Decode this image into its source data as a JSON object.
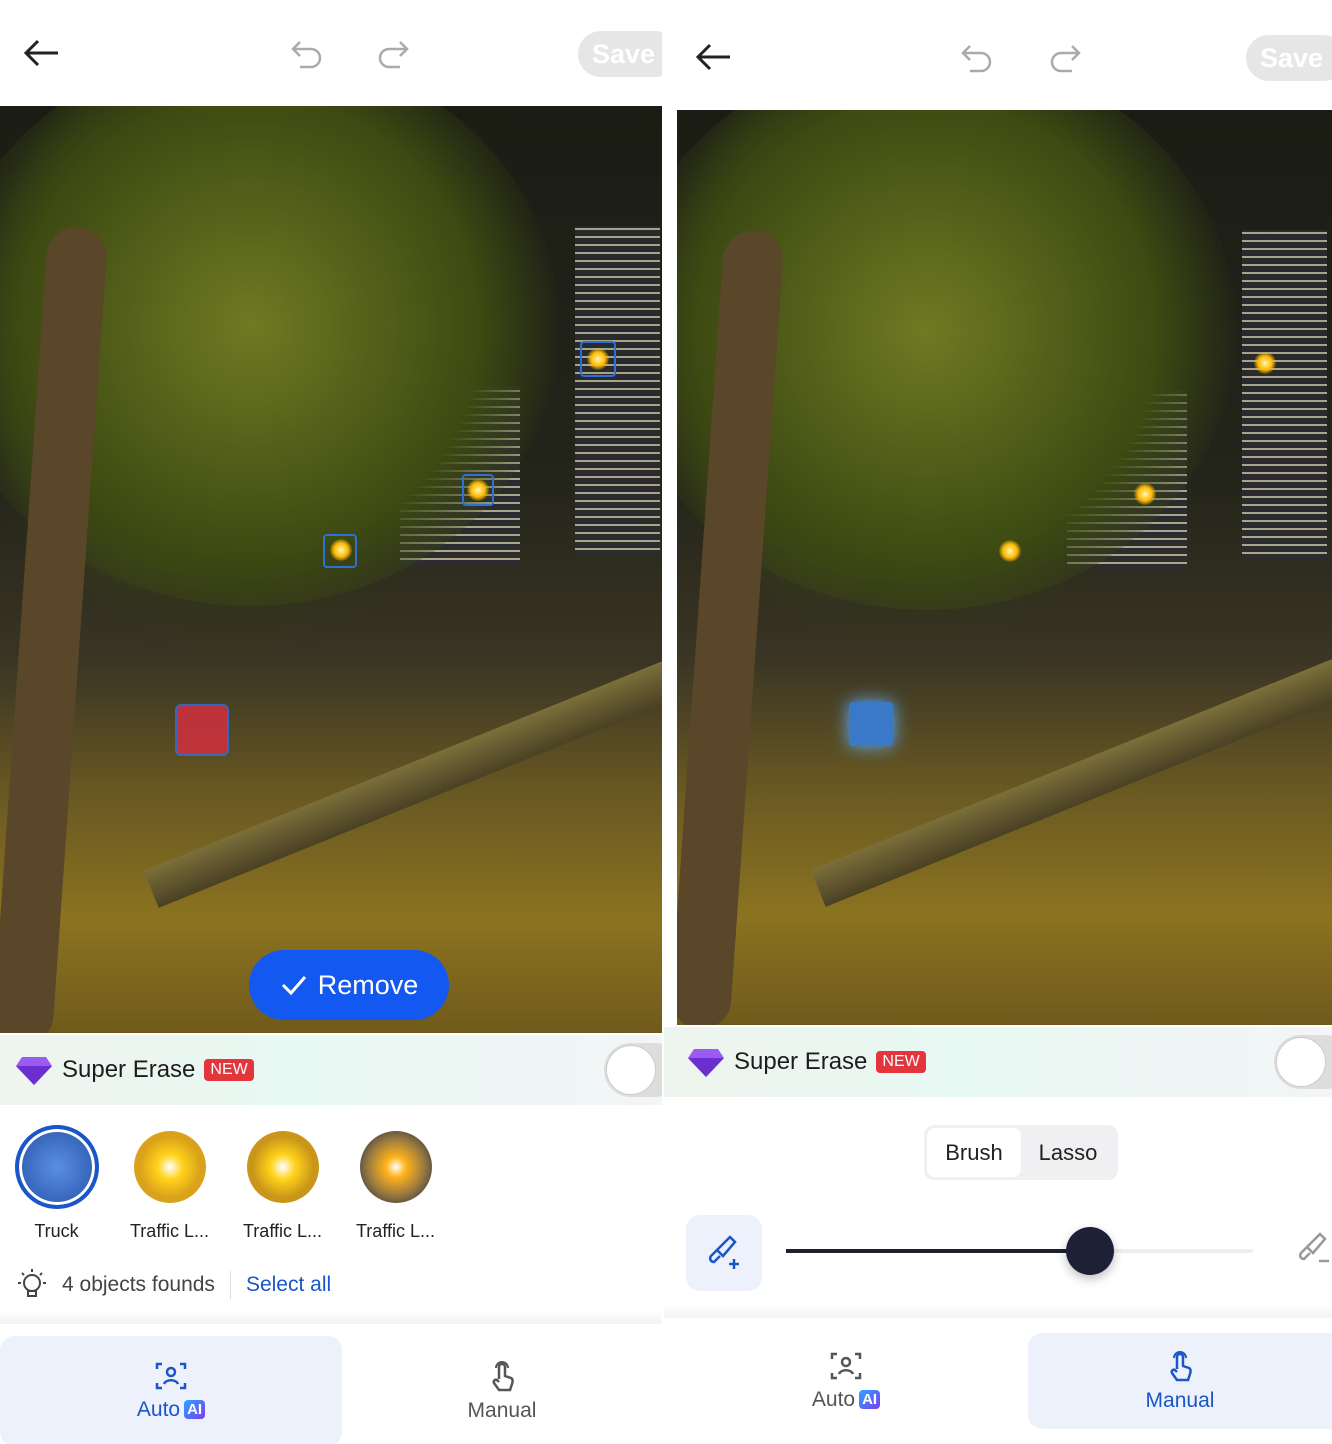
{
  "left": {
    "header": {
      "save_label": "Save"
    },
    "remove_label": "Remove",
    "super_erase": {
      "title": "Super Erase",
      "badge": "NEW",
      "enabled": false
    },
    "objects": [
      {
        "label": "Truck",
        "selected": true
      },
      {
        "label": "Traffic L...",
        "selected": false
      },
      {
        "label": "Traffic L...",
        "selected": false
      },
      {
        "label": "Traffic L...",
        "selected": false
      }
    ],
    "found_text": "4 objects founds",
    "select_all": "Select all",
    "nav": {
      "auto": "Auto",
      "ai_badge": "AI",
      "manual": "Manual",
      "active": "auto"
    }
  },
  "right": {
    "header": {
      "save_label": "Save"
    },
    "super_erase": {
      "title": "Super Erase",
      "badge": "NEW",
      "enabled": false
    },
    "modes": {
      "brush": "Brush",
      "lasso": "Lasso",
      "active": "brush"
    },
    "brush_size": 0.65,
    "nav": {
      "auto": "Auto",
      "ai_badge": "AI",
      "manual": "Manual",
      "active": "manual"
    }
  },
  "colors": {
    "accent": "#1358f0",
    "link": "#1a55c9",
    "badge": "#e2363c",
    "nav_active_bg": "#edf1fb"
  }
}
